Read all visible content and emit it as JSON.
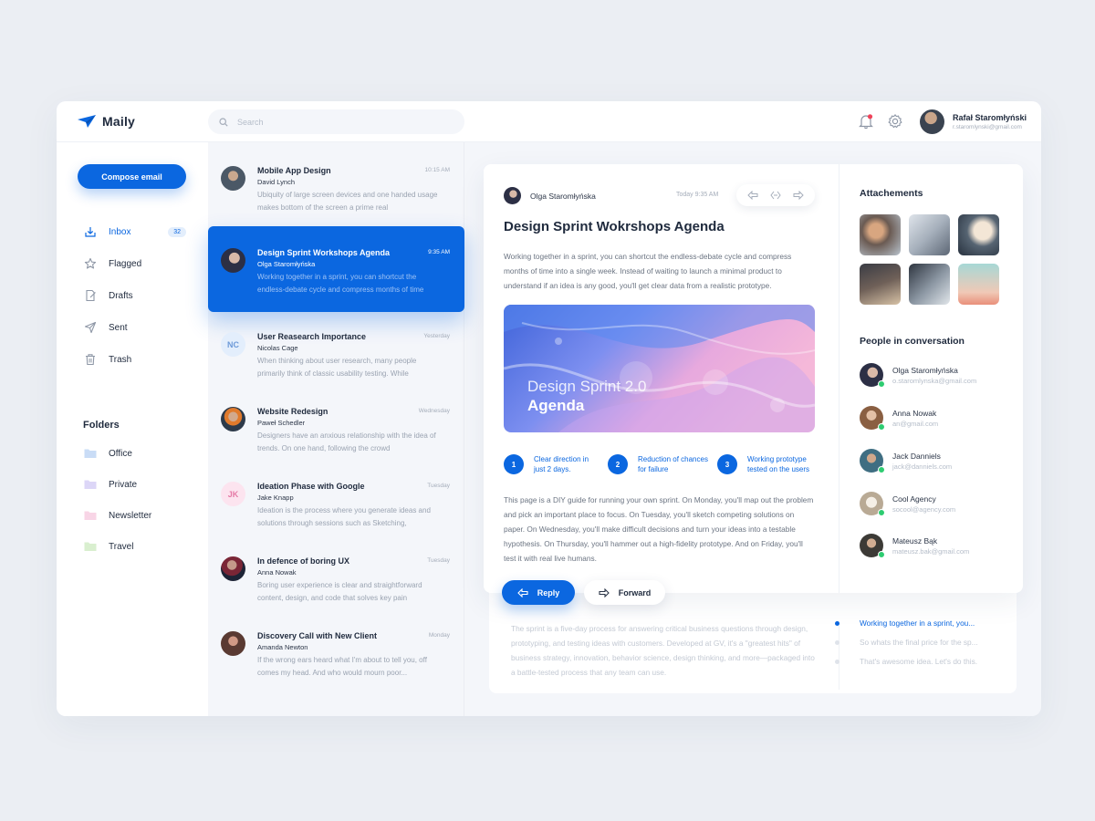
{
  "app": {
    "name": "Maily"
  },
  "search": {
    "placeholder": "Search"
  },
  "user": {
    "name": "Rafał Staromłyński",
    "email": "r.staromlynski@gmail.com"
  },
  "sidebar": {
    "compose_label": "Compose email",
    "nav": [
      {
        "label": "Inbox",
        "badge": "32"
      },
      {
        "label": "Flagged"
      },
      {
        "label": "Drafts"
      },
      {
        "label": "Sent"
      },
      {
        "label": "Trash"
      }
    ],
    "folders_title": "Folders",
    "folders": [
      {
        "label": "Office",
        "color": "#c9dcf6"
      },
      {
        "label": "Private",
        "color": "#dcd6f7"
      },
      {
        "label": "Newsletter",
        "color": "#f8d5e6"
      },
      {
        "label": "Travel",
        "color": "#d9efcf"
      }
    ]
  },
  "mails": [
    {
      "subject": "Mobile App Design",
      "from": "David Lynch",
      "time": "10:15 AM",
      "preview": "Ubiquity of large screen devices and one handed usage makes bottom of the screen a prime real"
    },
    {
      "subject": "Design Sprint Workshops Agenda",
      "from": "Olga Staromłyńska",
      "time": "9:35 AM",
      "preview": "Working together in a sprint, you can shortcut the endless-debate cycle and compress months of time"
    },
    {
      "subject": "User Reasearch Importance",
      "from": "Nicolas Cage",
      "time": "Yesterday",
      "preview": "When thinking about user research, many people primarily think of classic usability testing. While",
      "initials": "NC"
    },
    {
      "subject": "Website Redesign",
      "from": "Paweł Schedler",
      "time": "Wednesday",
      "preview": "Designers have an anxious relationship with the idea of trends. On one hand, following the crowd"
    },
    {
      "subject": "Ideation Phase with Google",
      "from": "Jake Knapp",
      "time": "Tuesday",
      "preview": "Ideation is the process where you generate ideas and solutions through sessions such as Sketching,",
      "initials": "JK"
    },
    {
      "subject": "In defence of boring UX",
      "from": "Anna Nowak",
      "time": "Tuesday",
      "preview": "Boring user experience is clear and straightforward content, design, and code that solves key pain"
    },
    {
      "subject": "Discovery Call with New Client",
      "from": "Amanda Newton",
      "time": "Monday",
      "preview": "If the wrong ears heard what I'm about to tell you, off comes my head. And who would mourn poor..."
    }
  ],
  "message": {
    "sender": "Olga Staromłyńska",
    "time": "Today 9:35 AM",
    "title": "Design Sprint Wokrshops Agenda",
    "intro": "Working together in a sprint, you can shortcut the endless-debate cycle and compress months of time into a single week. Instead of waiting to launch a minimal product to understand if an idea is any good, you'll get clear data from a realistic prototype.",
    "hero_line1": "Design Sprint 2.0",
    "hero_line2": "Agenda",
    "steps": [
      {
        "num": "1",
        "text": "Clear direction in just 2 days."
      },
      {
        "num": "2",
        "text": "Reduction of chances for failure"
      },
      {
        "num": "3",
        "text": "Working prototype tested on the users"
      }
    ],
    "body": "This page is a DIY guide for running your own sprint. On Monday, you'll map out the problem and pick an important place to focus. On Tuesday, you'll sketch competing solutions on paper. On Wednesday, you'll make difficult decisions and turn your ideas into a testable hypothesis. On Thursday, you'll hammer out a high-fidelity prototype. And on Friday, you'll test it with real live humans.",
    "reply_label": "Reply",
    "forward_label": "Forward"
  },
  "attachments_title": "Attachements",
  "people_title": "People in conversation",
  "people": [
    {
      "name": "Olga Staromłyńska",
      "email": "o.staromlynska@gmail.com"
    },
    {
      "name": "Anna Nowak",
      "email": "an@gmail.com"
    },
    {
      "name": "Jack Danniels",
      "email": "jack@danniels.com"
    },
    {
      "name": "Cool Agency",
      "email": "socool@agency.com"
    },
    {
      "name": "Mateusz Bąk",
      "email": "mateusz.bak@gmail.com"
    }
  ],
  "earlier": {
    "text": "The sprint is a five-day process for answering critical business questions through design, prototyping, and testing ideas with customers. Developed at GV, it's a \"greatest hits\" of business strategy, innovation, behavior science, design thinking, and more—packaged into a battle-tested process that any team can use.",
    "thread": [
      "Working together in a sprint, you...",
      "So whats the final price for the sp...",
      "That's awesome idea. Let's do this."
    ]
  },
  "colors": {
    "accent": "#0b67e0",
    "online": "#2ecc71"
  }
}
